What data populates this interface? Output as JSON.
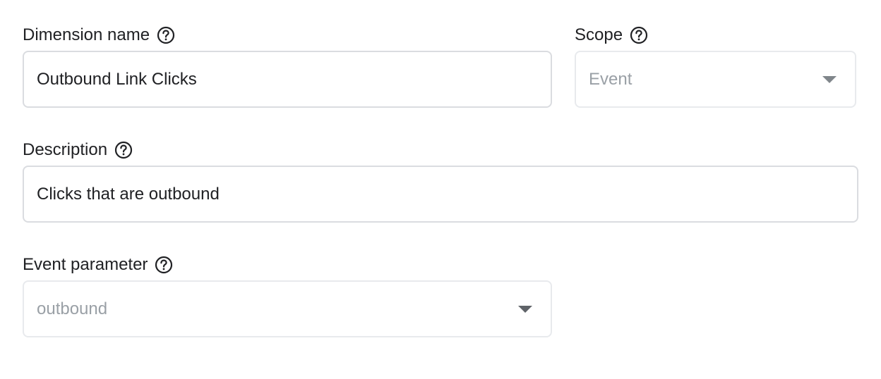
{
  "dimension_name": {
    "label": "Dimension name",
    "value": "Outbound Link Clicks",
    "help_icon": "help-circle-icon"
  },
  "scope": {
    "label": "Scope",
    "selected": "Event",
    "disabled": true,
    "help_icon": "help-circle-icon"
  },
  "description": {
    "label": "Description",
    "value": "Clicks that are outbound",
    "help_icon": "help-circle-icon"
  },
  "event_parameter": {
    "label": "Event parameter",
    "selected": "outbound",
    "disabled": true,
    "help_icon": "help-circle-icon"
  },
  "colors": {
    "border": "#dadce0",
    "disabled_text": "#9aa0a6",
    "text": "#202124"
  }
}
